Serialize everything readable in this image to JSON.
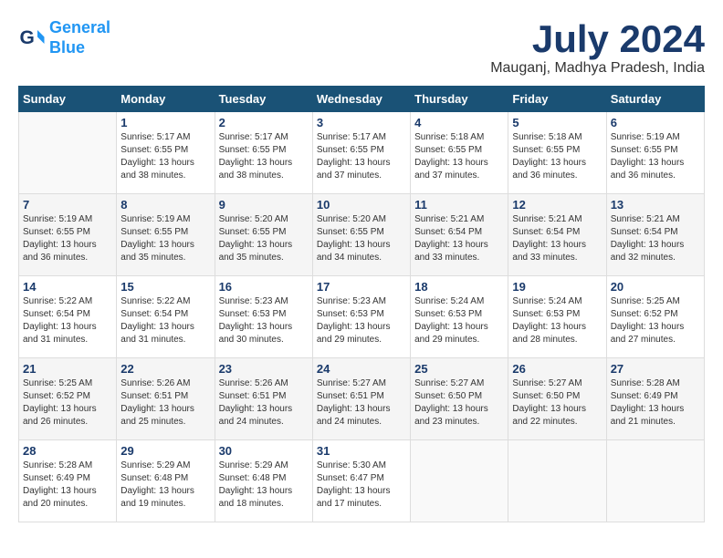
{
  "header": {
    "logo_line1": "General",
    "logo_line2": "Blue",
    "month_year": "July 2024",
    "location": "Mauganj, Madhya Pradesh, India"
  },
  "weekdays": [
    "Sunday",
    "Monday",
    "Tuesday",
    "Wednesday",
    "Thursday",
    "Friday",
    "Saturday"
  ],
  "weeks": [
    [
      {
        "day": "",
        "info": ""
      },
      {
        "day": "1",
        "info": "Sunrise: 5:17 AM\nSunset: 6:55 PM\nDaylight: 13 hours\nand 38 minutes."
      },
      {
        "day": "2",
        "info": "Sunrise: 5:17 AM\nSunset: 6:55 PM\nDaylight: 13 hours\nand 38 minutes."
      },
      {
        "day": "3",
        "info": "Sunrise: 5:17 AM\nSunset: 6:55 PM\nDaylight: 13 hours\nand 37 minutes."
      },
      {
        "day": "4",
        "info": "Sunrise: 5:18 AM\nSunset: 6:55 PM\nDaylight: 13 hours\nand 37 minutes."
      },
      {
        "day": "5",
        "info": "Sunrise: 5:18 AM\nSunset: 6:55 PM\nDaylight: 13 hours\nand 36 minutes."
      },
      {
        "day": "6",
        "info": "Sunrise: 5:19 AM\nSunset: 6:55 PM\nDaylight: 13 hours\nand 36 minutes."
      }
    ],
    [
      {
        "day": "7",
        "info": "Sunrise: 5:19 AM\nSunset: 6:55 PM\nDaylight: 13 hours\nand 36 minutes."
      },
      {
        "day": "8",
        "info": "Sunrise: 5:19 AM\nSunset: 6:55 PM\nDaylight: 13 hours\nand 35 minutes."
      },
      {
        "day": "9",
        "info": "Sunrise: 5:20 AM\nSunset: 6:55 PM\nDaylight: 13 hours\nand 35 minutes."
      },
      {
        "day": "10",
        "info": "Sunrise: 5:20 AM\nSunset: 6:55 PM\nDaylight: 13 hours\nand 34 minutes."
      },
      {
        "day": "11",
        "info": "Sunrise: 5:21 AM\nSunset: 6:54 PM\nDaylight: 13 hours\nand 33 minutes."
      },
      {
        "day": "12",
        "info": "Sunrise: 5:21 AM\nSunset: 6:54 PM\nDaylight: 13 hours\nand 33 minutes."
      },
      {
        "day": "13",
        "info": "Sunrise: 5:21 AM\nSunset: 6:54 PM\nDaylight: 13 hours\nand 32 minutes."
      }
    ],
    [
      {
        "day": "14",
        "info": "Sunrise: 5:22 AM\nSunset: 6:54 PM\nDaylight: 13 hours\nand 31 minutes."
      },
      {
        "day": "15",
        "info": "Sunrise: 5:22 AM\nSunset: 6:54 PM\nDaylight: 13 hours\nand 31 minutes."
      },
      {
        "day": "16",
        "info": "Sunrise: 5:23 AM\nSunset: 6:53 PM\nDaylight: 13 hours\nand 30 minutes."
      },
      {
        "day": "17",
        "info": "Sunrise: 5:23 AM\nSunset: 6:53 PM\nDaylight: 13 hours\nand 29 minutes."
      },
      {
        "day": "18",
        "info": "Sunrise: 5:24 AM\nSunset: 6:53 PM\nDaylight: 13 hours\nand 29 minutes."
      },
      {
        "day": "19",
        "info": "Sunrise: 5:24 AM\nSunset: 6:53 PM\nDaylight: 13 hours\nand 28 minutes."
      },
      {
        "day": "20",
        "info": "Sunrise: 5:25 AM\nSunset: 6:52 PM\nDaylight: 13 hours\nand 27 minutes."
      }
    ],
    [
      {
        "day": "21",
        "info": "Sunrise: 5:25 AM\nSunset: 6:52 PM\nDaylight: 13 hours\nand 26 minutes."
      },
      {
        "day": "22",
        "info": "Sunrise: 5:26 AM\nSunset: 6:51 PM\nDaylight: 13 hours\nand 25 minutes."
      },
      {
        "day": "23",
        "info": "Sunrise: 5:26 AM\nSunset: 6:51 PM\nDaylight: 13 hours\nand 24 minutes."
      },
      {
        "day": "24",
        "info": "Sunrise: 5:27 AM\nSunset: 6:51 PM\nDaylight: 13 hours\nand 24 minutes."
      },
      {
        "day": "25",
        "info": "Sunrise: 5:27 AM\nSunset: 6:50 PM\nDaylight: 13 hours\nand 23 minutes."
      },
      {
        "day": "26",
        "info": "Sunrise: 5:27 AM\nSunset: 6:50 PM\nDaylight: 13 hours\nand 22 minutes."
      },
      {
        "day": "27",
        "info": "Sunrise: 5:28 AM\nSunset: 6:49 PM\nDaylight: 13 hours\nand 21 minutes."
      }
    ],
    [
      {
        "day": "28",
        "info": "Sunrise: 5:28 AM\nSunset: 6:49 PM\nDaylight: 13 hours\nand 20 minutes."
      },
      {
        "day": "29",
        "info": "Sunrise: 5:29 AM\nSunset: 6:48 PM\nDaylight: 13 hours\nand 19 minutes."
      },
      {
        "day": "30",
        "info": "Sunrise: 5:29 AM\nSunset: 6:48 PM\nDaylight: 13 hours\nand 18 minutes."
      },
      {
        "day": "31",
        "info": "Sunrise: 5:30 AM\nSunset: 6:47 PM\nDaylight: 13 hours\nand 17 minutes."
      },
      {
        "day": "",
        "info": ""
      },
      {
        "day": "",
        "info": ""
      },
      {
        "day": "",
        "info": ""
      }
    ]
  ]
}
